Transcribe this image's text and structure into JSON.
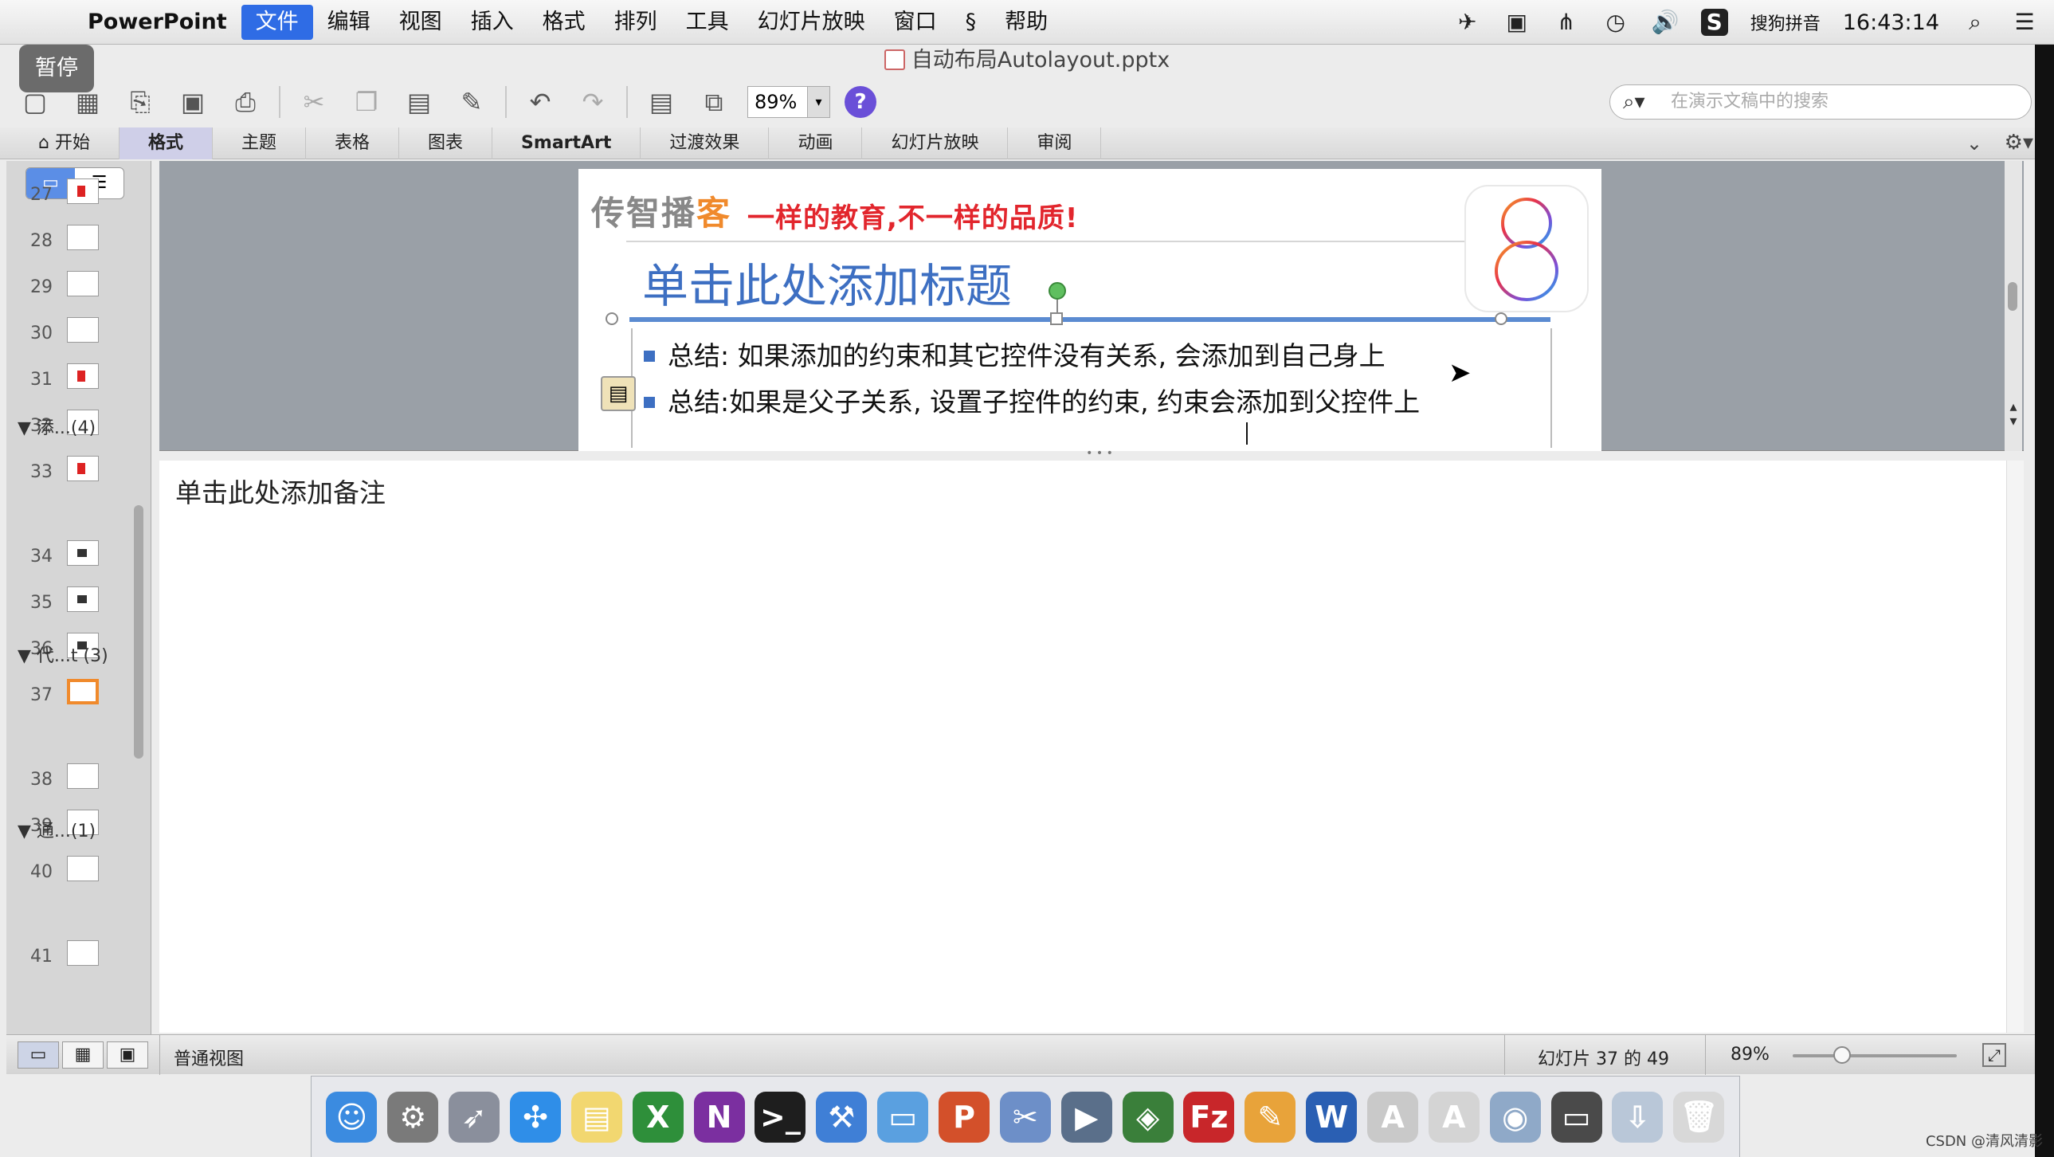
{
  "menubar": {
    "app": "PowerPoint",
    "items": [
      "文件",
      "编辑",
      "视图",
      "插入",
      "格式",
      "排列",
      "工具",
      "幻灯片放映",
      "窗口",
      "帮助"
    ],
    "active_index": 0,
    "input_method": "搜狗拼音",
    "clock": "16:43:14",
    "icons": [
      "apple-icon",
      "script-icon",
      "airplane-icon",
      "camera-icon",
      "wifi-icon",
      "time-machine-icon",
      "volume-icon",
      "sogou-icon",
      "spotlight-icon",
      "notification-icon"
    ]
  },
  "pause_badge": "暂停",
  "window": {
    "title": "自动布局Autolayout.pptx"
  },
  "toolbar": {
    "zoom": "89%",
    "help": "?",
    "search_placeholder": "在演示文稿中的搜索",
    "icons": [
      "new-icon",
      "gallery-icon",
      "open-icon",
      "save-icon",
      "print-icon",
      "cut-icon",
      "copy-icon",
      "paste-icon",
      "format-painter-icon",
      "undo-icon",
      "redo-icon",
      "slide-layout-icon",
      "new-slide-icon"
    ]
  },
  "ribbon": {
    "tabs": [
      "开始",
      "格式",
      "主题",
      "表格",
      "图表",
      "SmartArt",
      "过渡效果",
      "动画",
      "幻灯片放映",
      "审阅"
    ],
    "selected_index": 1
  },
  "slides_panel": {
    "rows": [
      {
        "num": "27",
        "kind": "red"
      },
      {
        "num": "28",
        "kind": "plain"
      },
      {
        "num": "29",
        "kind": "plain"
      },
      {
        "num": "30",
        "kind": "plain"
      },
      {
        "num": "31",
        "kind": "red"
      },
      {
        "num": "32",
        "kind": "plain"
      },
      {
        "num": "33",
        "kind": "red"
      },
      {
        "num": "34",
        "kind": "dark"
      },
      {
        "num": "35",
        "kind": "dark"
      },
      {
        "num": "36",
        "kind": "dark"
      },
      {
        "num": "37",
        "kind": "selected"
      },
      {
        "num": "38",
        "kind": "plain"
      },
      {
        "num": "39",
        "kind": "plain"
      },
      {
        "num": "40",
        "kind": "plain"
      },
      {
        "num": "41",
        "kind": "plain"
      }
    ],
    "sections": [
      "添...(4)",
      "代...t (3)",
      "通...(1)"
    ]
  },
  "slide": {
    "logo_gray": "传智播",
    "logo_orange": "客",
    "slogan": "一样的教育,不一样的品质!",
    "badge": "8",
    "title": "单击此处添加标题",
    "bullets": [
      "总结: 如果添加的约束和其它控件没有关系, 会添加到自己身上",
      "总结:如果是父子关系, 设置子控件的约束, 约束会添加到父控件上"
    ]
  },
  "notes": {
    "placeholder": "单击此处添加备注"
  },
  "statusbar": {
    "view": "普通视图",
    "slide_position": "幻灯片 37 的 49",
    "zoom": "89%",
    "zoom_level": 0.3
  },
  "dock": {
    "apps": [
      {
        "name": "finder-icon",
        "glyph": "☺",
        "color": "#3b8be0"
      },
      {
        "name": "system-preferences-icon",
        "glyph": "⚙",
        "color": "#7a7a7a"
      },
      {
        "name": "launchpad-icon",
        "glyph": "➶",
        "color": "#8a8f9c"
      },
      {
        "name": "safari-icon",
        "glyph": "✣",
        "color": "#2f8ee8"
      },
      {
        "name": "notes-icon",
        "glyph": "▤",
        "color": "#f2d770"
      },
      {
        "name": "excel-icon",
        "glyph": "X",
        "color": "#2e8f3a"
      },
      {
        "name": "onenote-icon",
        "glyph": "N",
        "color": "#7b2fa0"
      },
      {
        "name": "terminal-icon",
        "glyph": ">_",
        "color": "#1e1e1e"
      },
      {
        "name": "xcode-icon",
        "glyph": "⚒",
        "color": "#3f7fd6"
      },
      {
        "name": "folder-icon",
        "glyph": "▭",
        "color": "#5aa0e0"
      },
      {
        "name": "powerpoint-icon",
        "glyph": "P",
        "color": "#d3502a"
      },
      {
        "name": "scissors-icon",
        "glyph": "✂",
        "color": "#6d8fc8"
      },
      {
        "name": "movie-icon",
        "glyph": "▶",
        "color": "#5a6f8a"
      },
      {
        "name": "network-icon",
        "glyph": "◈",
        "color": "#3a7f3a"
      },
      {
        "name": "filezilla-icon",
        "glyph": "Fz",
        "color": "#c8262a"
      },
      {
        "name": "sketch-icon",
        "glyph": "✎",
        "color": "#e8a33a"
      },
      {
        "name": "word-icon",
        "glyph": "W",
        "color": "#2a5fb3"
      },
      {
        "name": "app-store-icon",
        "glyph": "A",
        "color": "#c9c9c9"
      },
      {
        "name": "text-edit-icon",
        "glyph": "A",
        "color": "#d4d4d4"
      },
      {
        "name": "preview-icon",
        "glyph": "◉",
        "color": "#8fa9c8"
      },
      {
        "name": "display-icon",
        "glyph": "▭",
        "color": "#4a4a4a"
      },
      {
        "name": "downloads-icon",
        "glyph": "⇩",
        "color": "#b9c7d8"
      },
      {
        "name": "trash-icon",
        "glyph": "🗑",
        "color": "#d8d8d8"
      }
    ]
  },
  "watermark": "CSDN @清风清影"
}
